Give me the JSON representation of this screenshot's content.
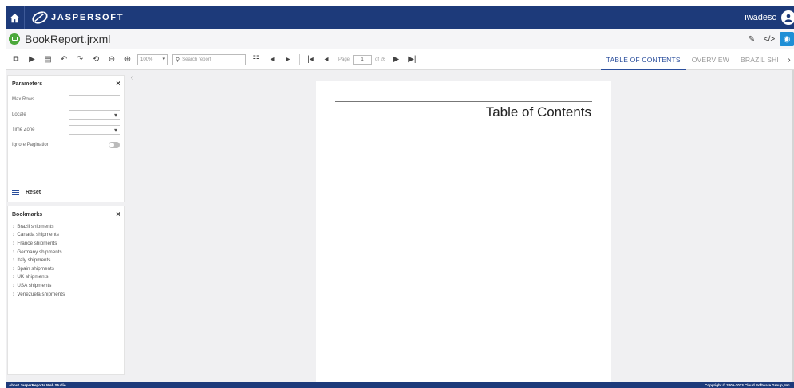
{
  "topbar": {
    "brand": "JASPERSOFT",
    "username": "iwadesc"
  },
  "titlebar": {
    "file_name": "BookReport.jrxml"
  },
  "toolbar": {
    "zoom_value": "100%",
    "search_placeholder": "Search report",
    "page_label": "Page",
    "page_value": "1",
    "page_of": "of 26"
  },
  "tabs": [
    {
      "label": "TABLE OF CONTENTS",
      "active": true
    },
    {
      "label": "OVERVIEW",
      "active": false
    },
    {
      "label": "BRAZIL SHI",
      "active": false
    }
  ],
  "parameters": {
    "title": "Parameters",
    "fields": [
      {
        "label": "Max Rows",
        "type": "text",
        "value": ""
      },
      {
        "label": "Locale",
        "type": "select",
        "value": ""
      },
      {
        "label": "Time Zone",
        "type": "select",
        "value": ""
      },
      {
        "label": "Ignore Pagination",
        "type": "toggle",
        "value": false
      }
    ],
    "reset_label": "Reset"
  },
  "bookmarks": {
    "title": "Bookmarks",
    "items": [
      "Brazil shipments",
      "Canada shipments",
      "France shipments",
      "Germany shipments",
      "Italy shipments",
      "Spain shipments",
      "UK shipments",
      "USA shipments",
      "Venezuela shipments"
    ]
  },
  "report": {
    "title": "Table of Contents"
  },
  "footer": {
    "left": "About JasperReports Web Studio",
    "right": "Copyright © 2005-2023 Cloud Software Group, Inc."
  },
  "colors": {
    "header": "#1d3a7a",
    "accent": "#2a4e9c",
    "file_icon": "#4ba83a"
  }
}
